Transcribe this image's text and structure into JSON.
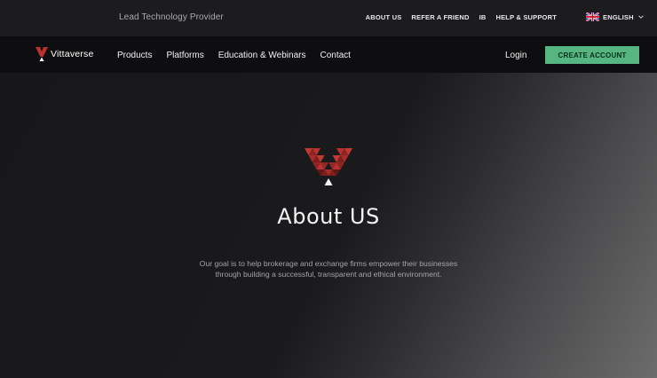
{
  "topbar": {
    "tagline": "Lead Technology Provider",
    "links": [
      "ABOUT US",
      "REFER A FRIEND",
      "IB",
      "HELP & SUPPORT"
    ],
    "language": {
      "label": "ENGLISH",
      "flag_icon": "uk-flag-icon"
    }
  },
  "navbar": {
    "brand": "Vittaverse",
    "items": [
      "Products",
      "Platforms",
      "Education & Webinars",
      "Contact"
    ],
    "login": "Login",
    "cta": "CREATE ACCOUNT"
  },
  "hero": {
    "title": "About US",
    "description": "Our goal is to help brokerage and exchange firms empower their businesses through building a successful, transparent and ethical environment."
  },
  "colors": {
    "brand_red": "#b8322f",
    "cta_green": "#56b682",
    "navbar_bg": "#0e0e10",
    "topbar_bg": "#1c1c1f"
  }
}
